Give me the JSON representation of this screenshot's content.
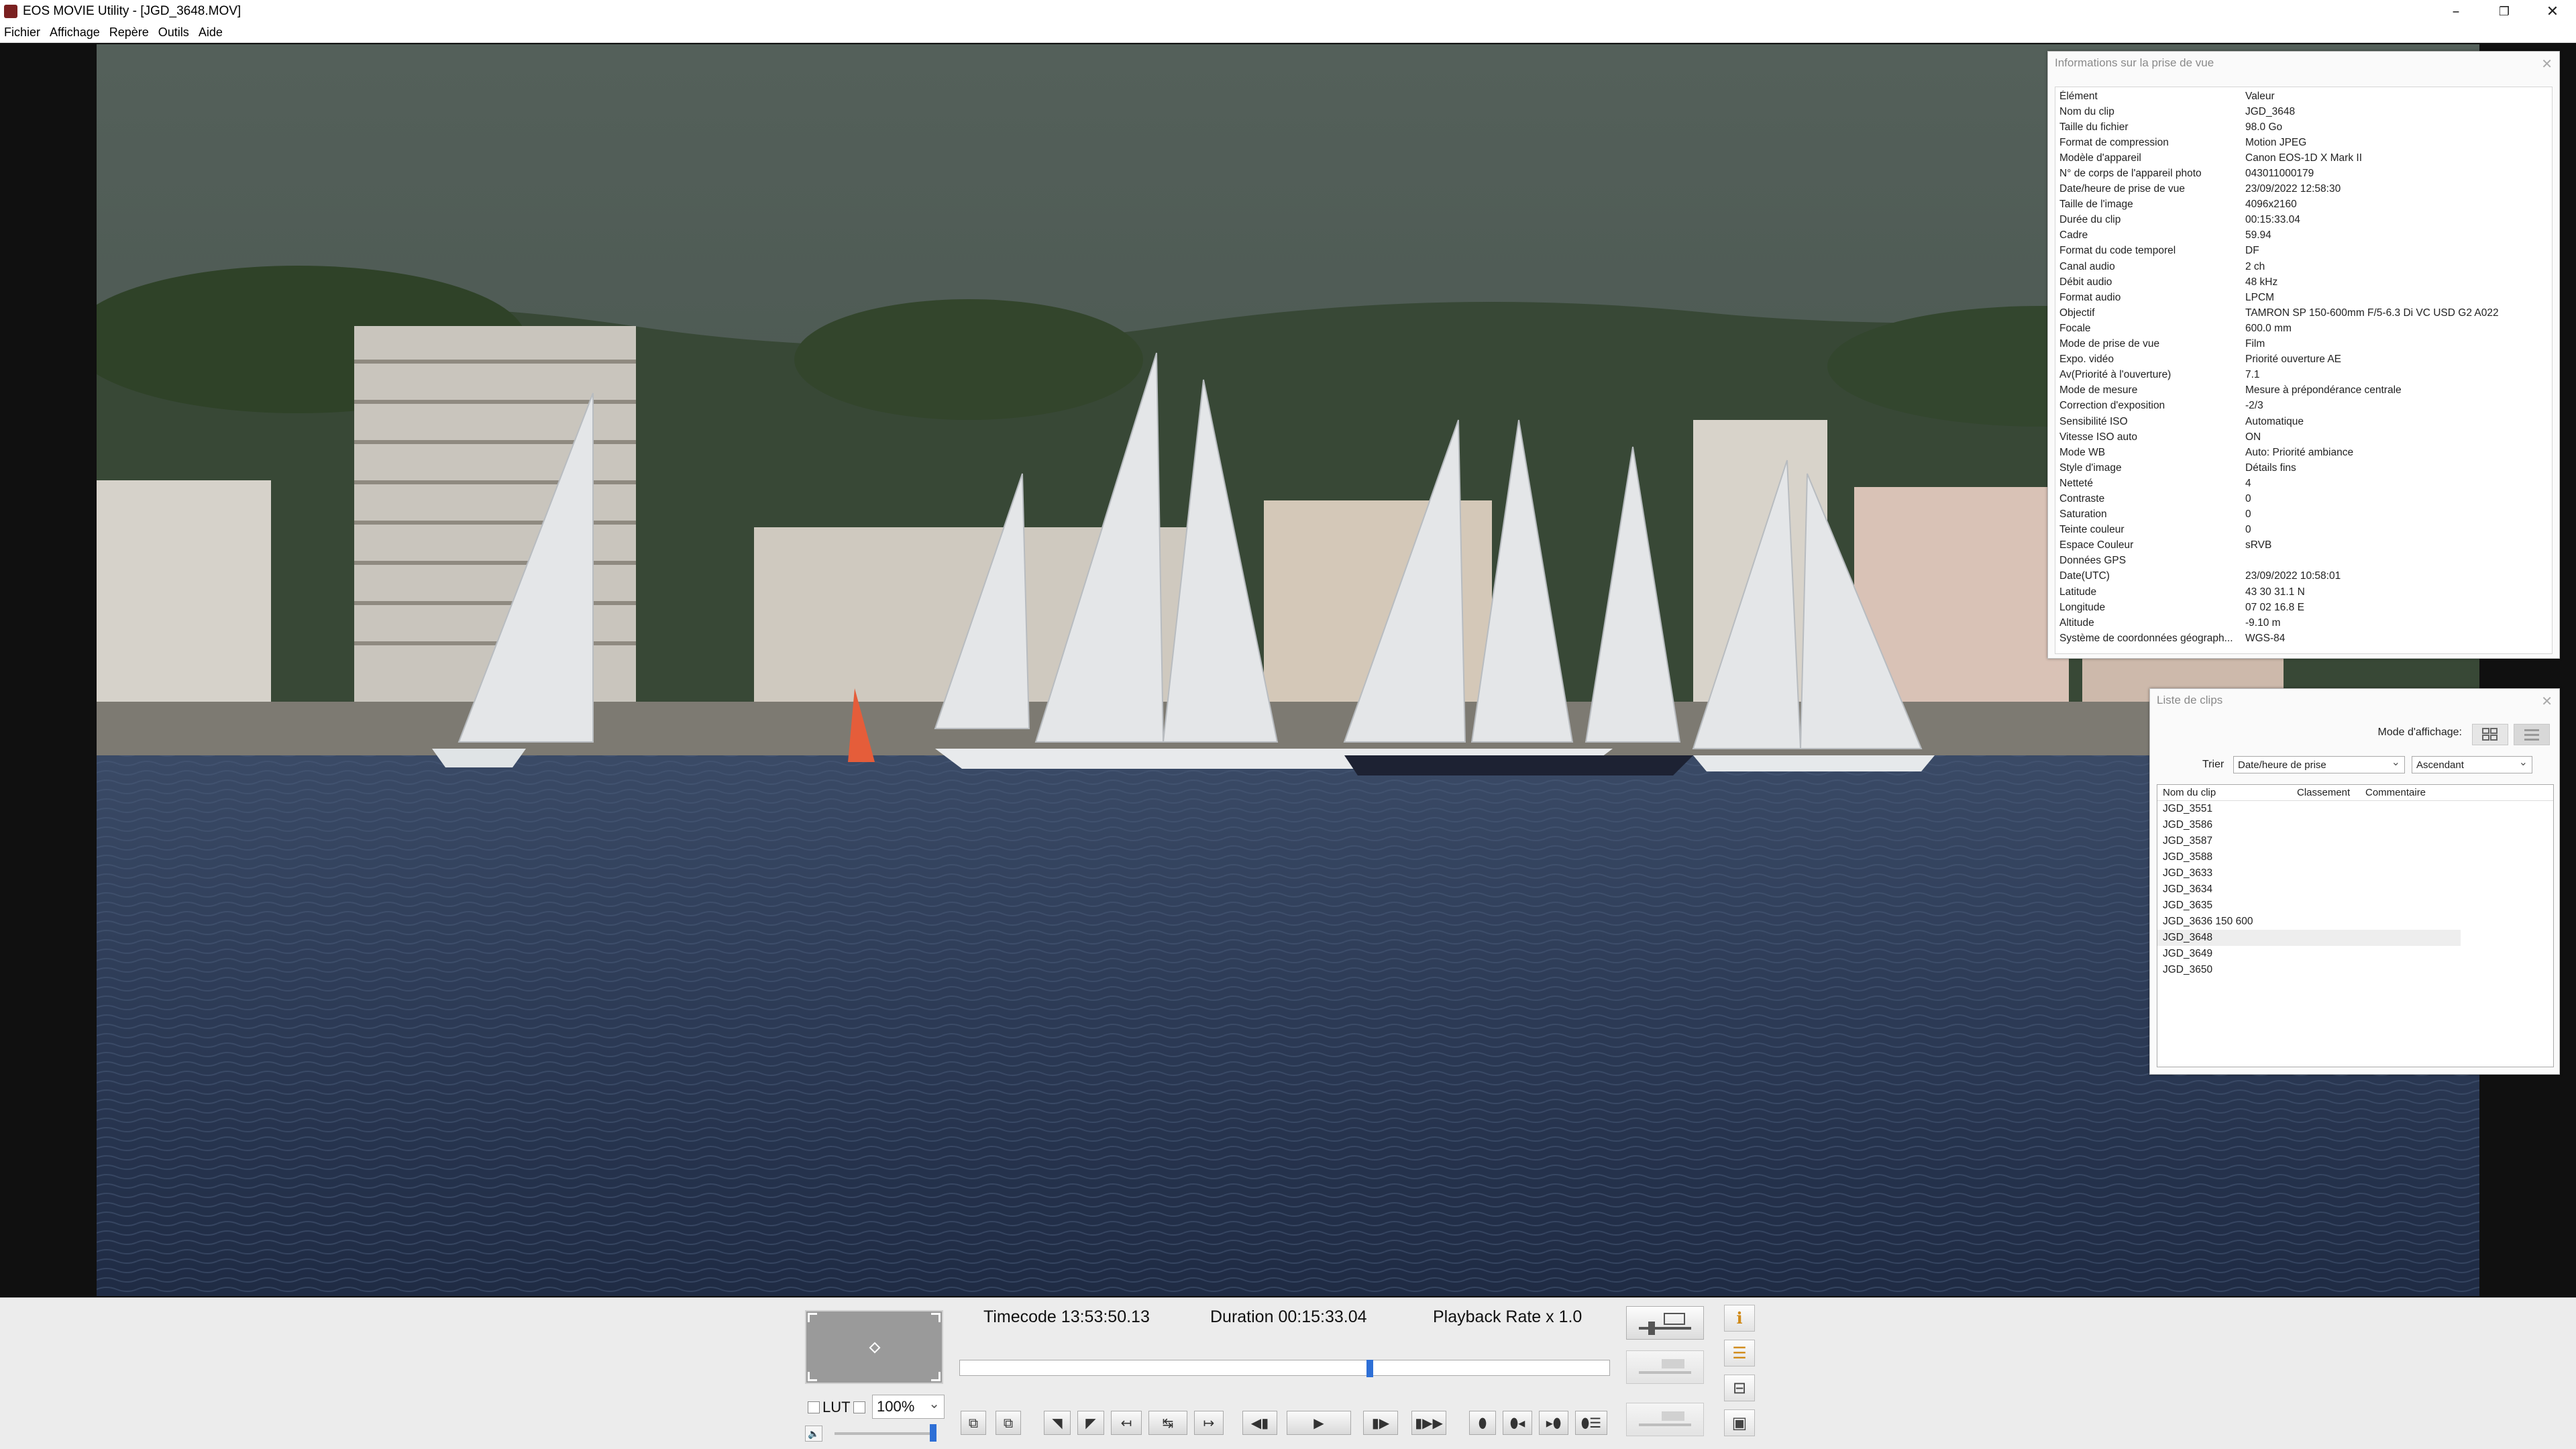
{
  "window": {
    "title": "EOS MOVIE Utility - [JGD_3648.MOV]",
    "minimize": "–",
    "maximize": "❐",
    "close": "✕"
  },
  "menu": [
    "Fichier",
    "Affichage",
    "Repère",
    "Outils",
    "Aide"
  ],
  "info_panel": {
    "title": "Informations sur la prise de vue",
    "header": {
      "k": "Élément",
      "v": "Valeur"
    },
    "rows": [
      {
        "k": "Nom du clip",
        "v": "JGD_3648"
      },
      {
        "k": "Taille du fichier",
        "v": "98.0 Go"
      },
      {
        "k": "Format de compression",
        "v": "Motion JPEG"
      },
      {
        "k": "Modèle d'appareil",
        "v": "Canon EOS-1D X Mark II"
      },
      {
        "k": "N° de corps de l'appareil photo",
        "v": "043011000179"
      },
      {
        "k": "Date/heure de prise de vue",
        "v": "23/09/2022 12:58:30"
      },
      {
        "k": "Taille de l'image",
        "v": "4096x2160"
      },
      {
        "k": "Durée du clip",
        "v": "00:15:33.04"
      },
      {
        "k": "Cadre",
        "v": "59.94"
      },
      {
        "k": "Format du code temporel",
        "v": "DF"
      },
      {
        "k": "Canal audio",
        "v": "2 ch"
      },
      {
        "k": "Débit audio",
        "v": "48 kHz"
      },
      {
        "k": "Format audio",
        "v": "LPCM"
      },
      {
        "k": "Objectif",
        "v": "TAMRON SP 150-600mm F/5-6.3 Di VC USD G2 A022"
      },
      {
        "k": "Focale",
        "v": "600.0 mm"
      },
      {
        "k": "Mode de prise de vue",
        "v": "Film"
      },
      {
        "k": "Expo. vidéo",
        "v": "Priorité ouverture AE"
      },
      {
        "k": "Av(Priorité à l'ouverture)",
        "v": "7.1"
      },
      {
        "k": "Mode de mesure",
        "v": "Mesure à prépondérance centrale"
      },
      {
        "k": "Correction d'exposition",
        "v": "-2/3"
      },
      {
        "k": "Sensibilité ISO",
        "v": "Automatique"
      },
      {
        "k": "Vitesse ISO auto",
        "v": "ON"
      },
      {
        "k": "Mode WB",
        "v": "Auto: Priorité ambiance"
      },
      {
        "k": "Style d'image",
        "v": "Détails fins"
      },
      {
        "k": "Netteté",
        "v": "4"
      },
      {
        "k": "Contraste",
        "v": "0"
      },
      {
        "k": "Saturation",
        "v": "0"
      },
      {
        "k": "Teinte couleur",
        "v": "0"
      },
      {
        "k": "Espace Couleur",
        "v": "sRVB"
      },
      {
        "k": "Données GPS",
        "v": ""
      },
      {
        "k": "Date(UTC)",
        "v": "23/09/2022 10:58:01"
      },
      {
        "k": "Latitude",
        "v": "43 30 31.1 N"
      },
      {
        "k": "Longitude",
        "v": "07 02 16.8 E"
      },
      {
        "k": "Altitude",
        "v": "-9.10 m"
      },
      {
        "k": "Système de coordonnées géograph...",
        "v": "WGS-84"
      }
    ]
  },
  "clip_panel": {
    "title": "Liste de clips",
    "mode_label": "Mode d'affichage:",
    "sort_label": "Trier",
    "sort_by": "Date/heure de prise",
    "sort_order": "Ascendant",
    "columns": [
      "Nom du clip",
      "Classement",
      "Commentaire"
    ],
    "clips": [
      "JGD_3551",
      "JGD_3586",
      "JGD_3587",
      "JGD_3588",
      "JGD_3633",
      "JGD_3634",
      "JGD_3635",
      "JGD_3636 150 600",
      "JGD_3648",
      "JGD_3649",
      "JGD_3650"
    ],
    "selected_index": 8
  },
  "playback": {
    "timecode": "Timecode 13:53:50.13",
    "duration": "Duration 00:15:33.04",
    "rate": "Playback Rate x 1.0",
    "lut_label": "LUT",
    "zoom": "100%",
    "position_fraction": 0.633,
    "volume_fraction": 1.0
  },
  "colors": {
    "accent": "#2e6fd6",
    "info_icon": "#d08a18"
  }
}
